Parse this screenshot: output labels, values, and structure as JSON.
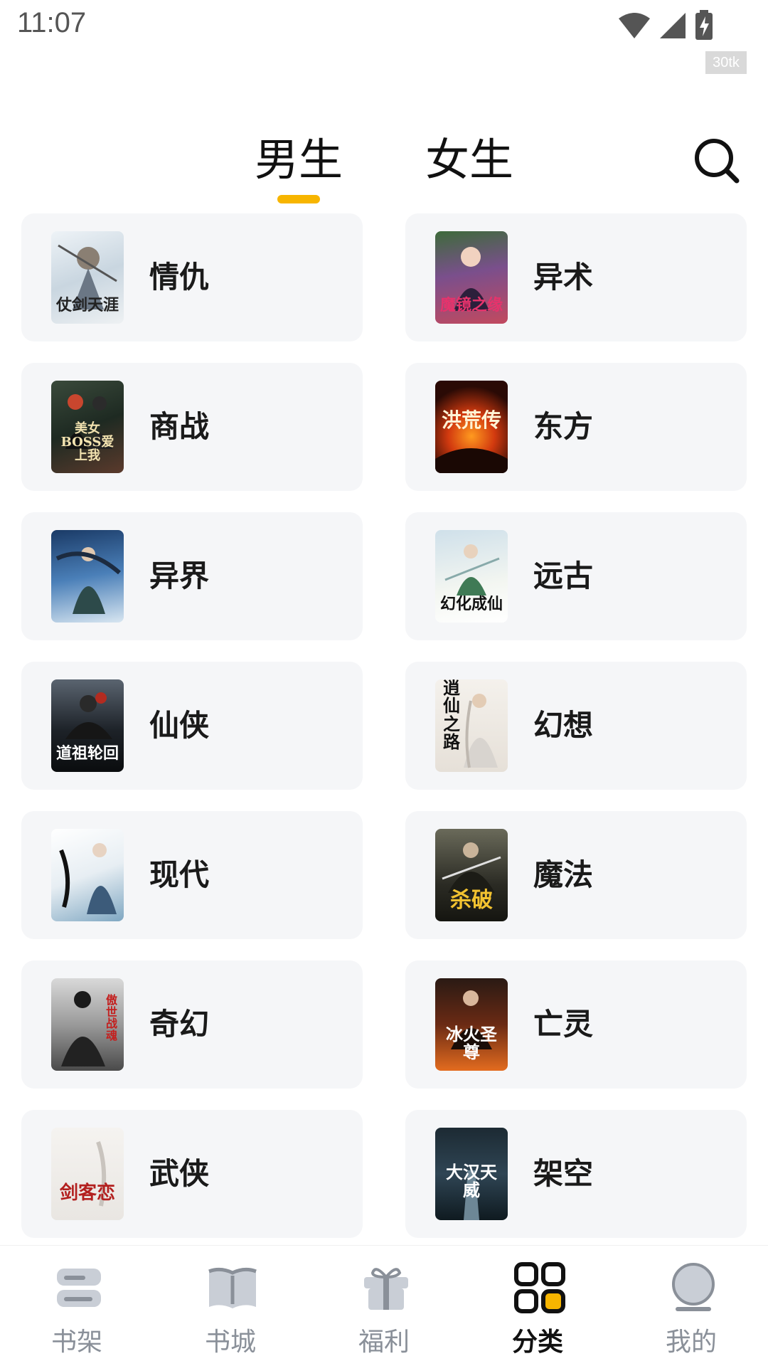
{
  "status": {
    "time": "11:07",
    "fps_badge": "30tk"
  },
  "tabs": [
    {
      "label": "男生",
      "active": true
    },
    {
      "label": "女生",
      "active": false
    }
  ],
  "accent_color": "#f7b500",
  "categories": [
    {
      "label": "情仇",
      "cover_text": "仗剑天涯"
    },
    {
      "label": "异术",
      "cover_text": "魔镜之缘"
    },
    {
      "label": "商战",
      "cover_text": "美女BOSS爱上我"
    },
    {
      "label": "东方",
      "cover_text": "洪荒传"
    },
    {
      "label": "异界",
      "cover_text": ""
    },
    {
      "label": "远古",
      "cover_text": "幻化成仙"
    },
    {
      "label": "仙侠",
      "cover_text": "道祖轮回"
    },
    {
      "label": "幻想",
      "cover_text": "逍仙之路"
    },
    {
      "label": "现代",
      "cover_text": ""
    },
    {
      "label": "魔法",
      "cover_text": "杀破"
    },
    {
      "label": "奇幻",
      "cover_text": "傲世战魂"
    },
    {
      "label": "亡灵",
      "cover_text": "冰火圣尊"
    },
    {
      "label": "武侠",
      "cover_text": "剑客恋"
    },
    {
      "label": "架空",
      "cover_text": "大汉天威"
    }
  ],
  "bottom_nav": [
    {
      "label": "书架",
      "icon": "bookshelf-icon",
      "active": false
    },
    {
      "label": "书城",
      "icon": "open-book-icon",
      "active": false
    },
    {
      "label": "福利",
      "icon": "gift-icon",
      "active": false
    },
    {
      "label": "分类",
      "icon": "category-grid-icon",
      "active": true
    },
    {
      "label": "我的",
      "icon": "profile-icon",
      "active": false
    }
  ]
}
